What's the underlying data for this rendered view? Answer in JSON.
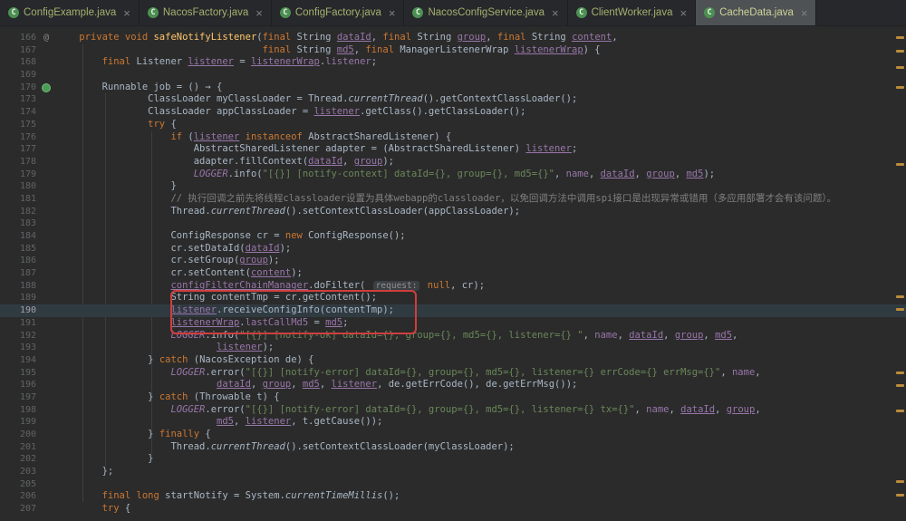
{
  "colors": {
    "editor_bg": "#2b2b2b",
    "tabbar_bg": "#26282b",
    "active_tab_bg": "#4e5254",
    "keyword": "#cc7832",
    "string": "#6a8759",
    "comment": "#808080",
    "field_purple": "#9876aa",
    "method_decl_yellow": "#ffc66d",
    "plain_text": "#a9b7c6",
    "line_number": "#606366",
    "annotation_box_red": "#cf3e3e",
    "warning_stripe": "#ba8c3c",
    "caret_line": "#303a41"
  },
  "tab_bar": {
    "tabs": [
      {
        "label": "ConfigExample.java",
        "icon_letter": "C",
        "close": "×",
        "active": false
      },
      {
        "label": "NacosFactory.java",
        "icon_letter": "C",
        "close": "×",
        "active": false
      },
      {
        "label": "ConfigFactory.java",
        "icon_letter": "C",
        "close": "×",
        "active": false
      },
      {
        "label": "NacosConfigService.java",
        "icon_letter": "C",
        "close": "×",
        "active": false
      },
      {
        "label": "ClientWorker.java",
        "icon_letter": "C",
        "close": "×",
        "active": false
      },
      {
        "label": "CacheData.java",
        "icon_letter": "C",
        "close": "×",
        "active": true
      }
    ]
  },
  "editor": {
    "active_line": "190",
    "lines": [
      {
        "num": "166",
        "icon": "at",
        "tokens": [
          [
            "p",
            "    "
          ],
          [
            "k",
            "private void "
          ],
          [
            "m",
            "safeNotifyListener"
          ],
          [
            "p",
            "("
          ],
          [
            "k",
            "final "
          ],
          [
            "p",
            "String "
          ],
          [
            "u",
            "dataId"
          ],
          [
            "p",
            ", "
          ],
          [
            "k",
            "final "
          ],
          [
            "p",
            "String "
          ],
          [
            "u",
            "group"
          ],
          [
            "p",
            ", "
          ],
          [
            "k",
            "final "
          ],
          [
            "p",
            "String "
          ],
          [
            "u",
            "content"
          ],
          [
            "p",
            ","
          ]
        ]
      },
      {
        "num": "167",
        "tokens": [
          [
            "p",
            "                                    "
          ],
          [
            "k",
            "final "
          ],
          [
            "p",
            "String "
          ],
          [
            "u",
            "md5"
          ],
          [
            "p",
            ", "
          ],
          [
            "k",
            "final "
          ],
          [
            "p",
            "ManagerListenerWrap "
          ],
          [
            "u",
            "listenerWrap"
          ],
          [
            "p",
            ") {"
          ]
        ]
      },
      {
        "num": "168",
        "tokens": [
          [
            "p",
            "        "
          ],
          [
            "k",
            "final "
          ],
          [
            "p",
            "Listener "
          ],
          [
            "u",
            "listener"
          ],
          [
            "p",
            " = "
          ],
          [
            "u",
            "listenerWrap"
          ],
          [
            "p",
            "."
          ],
          [
            "f",
            "listener"
          ],
          [
            "p",
            ";"
          ]
        ]
      },
      {
        "num": "169",
        "tokens": []
      },
      {
        "num": "170",
        "icon": "dot",
        "tokens": [
          [
            "p",
            "        "
          ],
          [
            "p",
            "Runnable job = "
          ],
          [
            "fold",
            "() → {"
          ]
        ]
      },
      {
        "num": "173",
        "tokens": [
          [
            "p",
            "                "
          ],
          [
            "p",
            "ClassLoader myClassLoader = Thread."
          ],
          [
            "st",
            "currentThread"
          ],
          [
            "p",
            "().getContextClassLoader();"
          ]
        ]
      },
      {
        "num": "174",
        "tokens": [
          [
            "p",
            "                "
          ],
          [
            "p",
            "ClassLoader appClassLoader = "
          ],
          [
            "u",
            "listener"
          ],
          [
            "p",
            ".getClass().getClassLoader();"
          ]
        ]
      },
      {
        "num": "175",
        "tokens": [
          [
            "p",
            "                "
          ],
          [
            "k",
            "try"
          ],
          [
            "p",
            " {"
          ]
        ]
      },
      {
        "num": "176",
        "tokens": [
          [
            "p",
            "                    "
          ],
          [
            "k",
            "if"
          ],
          [
            "p",
            " ("
          ],
          [
            "u",
            "listener"
          ],
          [
            "p",
            " "
          ],
          [
            "k",
            "instanceof"
          ],
          [
            "p",
            " AbstractSharedListener) {"
          ]
        ]
      },
      {
        "num": "177",
        "tokens": [
          [
            "p",
            "                        "
          ],
          [
            "p",
            "AbstractSharedListener adapter = (AbstractSharedListener) "
          ],
          [
            "u",
            "listener"
          ],
          [
            "p",
            ";"
          ]
        ]
      },
      {
        "num": "178",
        "tokens": [
          [
            "p",
            "                        "
          ],
          [
            "p",
            "adapter.fillContext("
          ],
          [
            "u",
            "dataId"
          ],
          [
            "p",
            ", "
          ],
          [
            "u",
            "group"
          ],
          [
            "p",
            ");"
          ]
        ]
      },
      {
        "num": "179",
        "tokens": [
          [
            "p",
            "                        "
          ],
          [
            "sf",
            "LOGGER"
          ],
          [
            "p",
            ".info("
          ],
          [
            "s",
            "\"[{}] [notify-context] dataId={}, group={}, md5={}\""
          ],
          [
            "p",
            ", "
          ],
          [
            "f",
            "name"
          ],
          [
            "p",
            ", "
          ],
          [
            "u",
            "dataId"
          ],
          [
            "p",
            ", "
          ],
          [
            "u",
            "group"
          ],
          [
            "p",
            ", "
          ],
          [
            "u",
            "md5"
          ],
          [
            "p",
            ");"
          ]
        ]
      },
      {
        "num": "180",
        "tokens": [
          [
            "p",
            "                    "
          ],
          [
            "p",
            "}"
          ]
        ]
      },
      {
        "num": "181",
        "tokens": [
          [
            "p",
            "                    "
          ],
          [
            "c",
            "// 执行回调之前先将线程classloader设置为具体webapp的classloader，以免回调方法中调用spi接口是出现异常或错用（多应用部署才会有该问题）。"
          ]
        ]
      },
      {
        "num": "182",
        "tokens": [
          [
            "p",
            "                    "
          ],
          [
            "p",
            "Thread."
          ],
          [
            "st",
            "currentThread"
          ],
          [
            "p",
            "().setContextClassLoader(appClassLoader);"
          ]
        ]
      },
      {
        "num": "183",
        "tokens": []
      },
      {
        "num": "184",
        "tokens": [
          [
            "p",
            "                    "
          ],
          [
            "p",
            "ConfigResponse cr = "
          ],
          [
            "k",
            "new"
          ],
          [
            "p",
            " ConfigResponse();"
          ]
        ]
      },
      {
        "num": "185",
        "tokens": [
          [
            "p",
            "                    "
          ],
          [
            "p",
            "cr.setDataId("
          ],
          [
            "u",
            "dataId"
          ],
          [
            "p",
            ");"
          ]
        ]
      },
      {
        "num": "186",
        "tokens": [
          [
            "p",
            "                    "
          ],
          [
            "p",
            "cr.setGroup("
          ],
          [
            "u",
            "group"
          ],
          [
            "p",
            ");"
          ]
        ]
      },
      {
        "num": "187",
        "tokens": [
          [
            "p",
            "                    "
          ],
          [
            "p",
            "cr.setContent("
          ],
          [
            "u",
            "content"
          ],
          [
            "p",
            ");"
          ]
        ]
      },
      {
        "num": "188",
        "tokens": [
          [
            "p",
            "                    "
          ],
          [
            "u",
            "configFilterChainManager"
          ],
          [
            "p",
            ".doFilter( "
          ],
          [
            "h",
            "request:"
          ],
          [
            "p",
            " "
          ],
          [
            "k",
            "null"
          ],
          [
            "p",
            ", cr);"
          ]
        ]
      },
      {
        "num": "189",
        "tokens": [
          [
            "p",
            "                    "
          ],
          [
            "p",
            "String contentTmp = cr.getContent();"
          ]
        ]
      },
      {
        "num": "190",
        "tokens": [
          [
            "p",
            "                    "
          ],
          [
            "u",
            "listener"
          ],
          [
            "p",
            ".receiveConfigInfo(contentTmp);"
          ]
        ]
      },
      {
        "num": "191",
        "tokens": [
          [
            "p",
            "                    "
          ],
          [
            "u",
            "listenerWrap"
          ],
          [
            "p",
            "."
          ],
          [
            "f",
            "lastCallMd5"
          ],
          [
            "p",
            " = "
          ],
          [
            "u",
            "md5"
          ],
          [
            "p",
            ";"
          ]
        ]
      },
      {
        "num": "192",
        "tokens": [
          [
            "p",
            "                    "
          ],
          [
            "sf",
            "LOGGER"
          ],
          [
            "p",
            ".info("
          ],
          [
            "s",
            "\"[{}] [notify-ok] dataId={}, group={}, md5={}, listener={} \""
          ],
          [
            "p",
            ", "
          ],
          [
            "f",
            "name"
          ],
          [
            "p",
            ", "
          ],
          [
            "u",
            "dataId"
          ],
          [
            "p",
            ", "
          ],
          [
            "u",
            "group"
          ],
          [
            "p",
            ", "
          ],
          [
            "u",
            "md5"
          ],
          [
            "p",
            ","
          ]
        ]
      },
      {
        "num": "193",
        "tokens": [
          [
            "p",
            "                            "
          ],
          [
            "u",
            "listener"
          ],
          [
            "p",
            ");"
          ]
        ]
      },
      {
        "num": "194",
        "tokens": [
          [
            "p",
            "                "
          ],
          [
            "p",
            "} "
          ],
          [
            "k",
            "catch"
          ],
          [
            "p",
            " (NacosException de) {"
          ]
        ]
      },
      {
        "num": "195",
        "tokens": [
          [
            "p",
            "                    "
          ],
          [
            "sf",
            "LOGGER"
          ],
          [
            "p",
            ".error("
          ],
          [
            "s",
            "\"[{}] [notify-error] dataId={}, group={}, md5={}, listener={} errCode={} errMsg={}\""
          ],
          [
            "p",
            ", "
          ],
          [
            "f",
            "name"
          ],
          [
            "p",
            ","
          ]
        ]
      },
      {
        "num": "196",
        "tokens": [
          [
            "p",
            "                            "
          ],
          [
            "u",
            "dataId"
          ],
          [
            "p",
            ", "
          ],
          [
            "u",
            "group"
          ],
          [
            "p",
            ", "
          ],
          [
            "u",
            "md5"
          ],
          [
            "p",
            ", "
          ],
          [
            "u",
            "listener"
          ],
          [
            "p",
            ", de.getErrCode(), de.getErrMsg());"
          ]
        ]
      },
      {
        "num": "197",
        "tokens": [
          [
            "p",
            "                "
          ],
          [
            "p",
            "} "
          ],
          [
            "k",
            "catch"
          ],
          [
            "p",
            " (Throwable t) {"
          ]
        ]
      },
      {
        "num": "198",
        "tokens": [
          [
            "p",
            "                    "
          ],
          [
            "sf",
            "LOGGER"
          ],
          [
            "p",
            ".error("
          ],
          [
            "s",
            "\"[{}] [notify-error] dataId={}, group={}, md5={}, listener={} tx={}\""
          ],
          [
            "p",
            ", "
          ],
          [
            "f",
            "name"
          ],
          [
            "p",
            ", "
          ],
          [
            "u",
            "dataId"
          ],
          [
            "p",
            ", "
          ],
          [
            "u",
            "group"
          ],
          [
            "p",
            ","
          ]
        ]
      },
      {
        "num": "199",
        "tokens": [
          [
            "p",
            "                            "
          ],
          [
            "u",
            "md5"
          ],
          [
            "p",
            ", "
          ],
          [
            "u",
            "listener"
          ],
          [
            "p",
            ", t.getCause());"
          ]
        ]
      },
      {
        "num": "200",
        "tokens": [
          [
            "p",
            "                "
          ],
          [
            "p",
            "} "
          ],
          [
            "k",
            "finally"
          ],
          [
            "p",
            " {"
          ]
        ]
      },
      {
        "num": "201",
        "tokens": [
          [
            "p",
            "                    "
          ],
          [
            "p",
            "Thread."
          ],
          [
            "st",
            "currentThread"
          ],
          [
            "p",
            "().setContextClassLoader(myClassLoader);"
          ]
        ]
      },
      {
        "num": "202",
        "tokens": [
          [
            "p",
            "                "
          ],
          [
            "p",
            "}"
          ]
        ]
      },
      {
        "num": "203",
        "tokens": [
          [
            "p",
            "        "
          ],
          [
            "p",
            "};"
          ]
        ]
      },
      {
        "num": "205",
        "tokens": []
      },
      {
        "num": "206",
        "tokens": [
          [
            "p",
            "        "
          ],
          [
            "k",
            "final long"
          ],
          [
            "p",
            " startNotify = System."
          ],
          [
            "st",
            "currentTimeMillis"
          ],
          [
            "p",
            "();"
          ]
        ]
      },
      {
        "num": "207",
        "tokens": [
          [
            "p",
            "        "
          ],
          [
            "k",
            "try"
          ],
          [
            "p",
            " {"
          ]
        ]
      }
    ]
  },
  "stripe_marks": [
    40,
    55,
    73,
    95,
    180,
    326,
    340,
    410,
    424,
    452,
    530,
    545
  ]
}
